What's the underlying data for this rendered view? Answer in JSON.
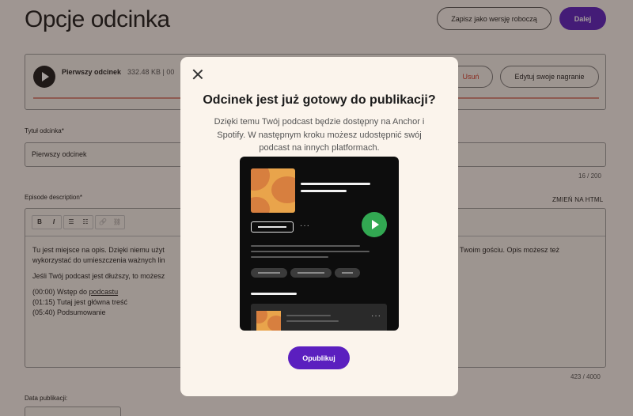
{
  "page": {
    "title": "Opcje odcinka",
    "save_draft_label": "Zapisz jako wersję roboczą",
    "next_label": "Dalej"
  },
  "audio": {
    "episode_name": "Pierwszy odcinek",
    "file_size": "332.48 KB | 00",
    "delete_label": "Usuń",
    "edit_label": "Edytuj swoje nagranie"
  },
  "form": {
    "title_label": "Tytuł odcinka*",
    "title_value": "Pierwszy odcinek",
    "title_counter": "16 / 200",
    "description_label": "Episode description*",
    "switch_html_label": "ZMIEŃ NA HTML",
    "toolbar": {
      "bold": "B",
      "italic": "I",
      "bullet_list": "☰",
      "numbered_list": "☷",
      "link": "🔗",
      "unlink": "⛓"
    },
    "description_lines": [
      "Tu jest miejsce na opis. Dzięki niemu użyt",
      "wykorzystać do umieszczenia ważnych lin",
      "Jeśli Twój podcast jest dłuższy, to możesz"
    ],
    "description_right": [
      "Twoim gościu. Opis możesz też"
    ],
    "chapters": [
      {
        "prefix": "(00:00) Wstęp do ",
        "link": "podcastu"
      },
      {
        "prefix": "(01:15) Tutaj jest główna treść",
        "link": ""
      },
      {
        "prefix": "(05:40) Podsumowanie",
        "link": ""
      }
    ],
    "description_counter": "423 / 4000",
    "publish_date_label": "Data publikacji:"
  },
  "modal": {
    "title": "Odcinek jest już gotowy do publikacji?",
    "description": "Dzięki temu Twój podcast będzie dostępny na Anchor i Spotify. W następnym kroku możesz udostępnić swój podcast na innych platformach.",
    "publish_label": "Opublikuj",
    "more_dots": "···"
  },
  "colors": {
    "accent": "#5b1fbf",
    "spotify_green": "#32a852",
    "cover_orange": "#e9a44b",
    "delete_red": "#d23b2a"
  },
  "icons": {
    "close": "close-icon",
    "play": "play-icon",
    "illustration_play": "play-icon"
  }
}
